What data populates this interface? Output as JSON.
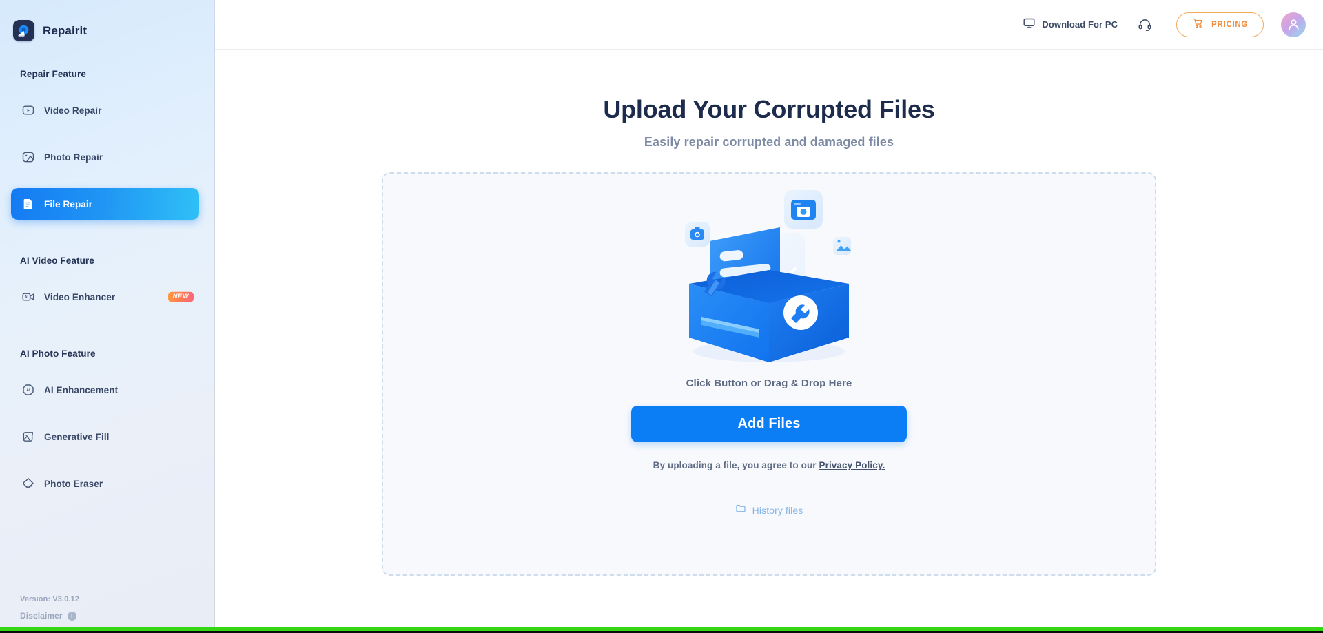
{
  "brand": {
    "name": "Repairit",
    "logo_icon": "repairit-logo-icon"
  },
  "sidebar": {
    "sections": [
      {
        "title": "Repair Feature",
        "items": [
          {
            "label": "Video Repair",
            "icon": "video-play-icon",
            "active": false,
            "badge": ""
          },
          {
            "label": "Photo Repair",
            "icon": "photo-image-icon",
            "active": false,
            "badge": ""
          },
          {
            "label": "File Repair",
            "icon": "document-file-icon",
            "active": true,
            "badge": ""
          }
        ]
      },
      {
        "title": "AI Video Feature",
        "items": [
          {
            "label": "Video Enhancer",
            "icon": "ai-video-camera-icon",
            "active": false,
            "badge": "NEW"
          }
        ]
      },
      {
        "title": "AI Photo Feature",
        "items": [
          {
            "label": "AI Enhancement",
            "icon": "ai-sparkle-badge-icon",
            "active": false,
            "badge": ""
          },
          {
            "label": "Generative Fill",
            "icon": "generative-fill-icon",
            "active": false,
            "badge": ""
          },
          {
            "label": "Photo Eraser",
            "icon": "eraser-icon",
            "active": false,
            "badge": ""
          }
        ]
      }
    ],
    "footer": {
      "version": "Version: V3.0.12",
      "disclaimer": "Disclaimer",
      "info_icon": "info-circle-icon"
    }
  },
  "topbar": {
    "download_label": "Download For PC",
    "download_icon": "monitor-icon",
    "support_icon": "headset-support-icon",
    "pricing_label": "PRICING",
    "pricing_icon": "shopping-cart-icon",
    "avatar_icon": "user-avatar-icon"
  },
  "main": {
    "title": "Upload Your Corrupted Files",
    "subtitle": "Easily repair corrupted and damaged files",
    "illustration": "toolbox-repair-files-illustration",
    "drop_hint": "Click Button or Drag & Drop Here",
    "add_files_label": "Add Files",
    "policy_prefix": "By uploading a file, you agree to our ",
    "policy_link": "Privacy Policy.",
    "history_label": "History files",
    "history_icon": "folder-icon"
  },
  "colors": {
    "accent_blue": "#0b7ef5",
    "active_gradient_start": "#157af3",
    "active_gradient_end": "#2fc0f6",
    "pricing_orange": "#ef8b3c",
    "badge_new_start": "#ff9b3f",
    "badge_new_end": "#f9687f",
    "bottom_bar_green": "#35d613",
    "title_navy": "#1d2b4c",
    "muted_text": "#7d8aa3",
    "history_blue": "#84b6e8",
    "dropzone_border": "#cfdcec"
  }
}
